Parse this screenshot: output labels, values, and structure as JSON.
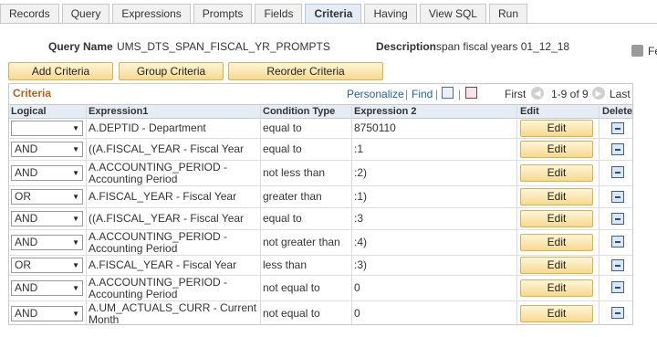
{
  "tabs": [
    {
      "label": "Records"
    },
    {
      "label": "Query"
    },
    {
      "label": "Expressions"
    },
    {
      "label": "Prompts"
    },
    {
      "label": "Fields"
    },
    {
      "label": "Criteria"
    },
    {
      "label": "Having"
    },
    {
      "label": "View SQL"
    },
    {
      "label": "Run"
    }
  ],
  "header": {
    "query_name_label": "Query Name",
    "query_name_value": "UMS_DTS_SPAN_FISCAL_YR_PROMPTS",
    "description_label": "Description",
    "description_value": "span fiscal years 01_12_18",
    "rss_icon": "rss-icon",
    "clipped_text": "Fe"
  },
  "buttons": {
    "add": "Add Criteria",
    "group": "Group Criteria",
    "reorder": "Reorder Criteria"
  },
  "grid": {
    "title": "Criteria",
    "personalize": "Personalize",
    "sep": "|",
    "find": "Find",
    "first": "First",
    "range": "1-9 of 9",
    "last": "Last",
    "columns": {
      "logical": "Logical",
      "expression1": "Expression1",
      "condition": "Condition Type",
      "expression2": "Expression 2",
      "edit": "Edit",
      "delete": "Delete"
    },
    "edit_label": "Edit",
    "rows": [
      {
        "logical": "",
        "expr1a": "A.DEPTID - Department",
        "expr1b": "",
        "condition": "equal to",
        "expr2": "8750110"
      },
      {
        "logical": "AND",
        "expr1a": "((A.FISCAL_YEAR - Fiscal Year",
        "expr1b": "",
        "condition": "equal to",
        "expr2": ":1"
      },
      {
        "logical": "AND",
        "expr1a": "A.ACCOUNTING_PERIOD -",
        "expr1b": "Accounting Period",
        "condition": "not less than",
        "expr2": ":2)"
      },
      {
        "logical": "OR",
        "expr1a": "A.FISCAL_YEAR - Fiscal Year",
        "expr1b": "",
        "condition": "greater than",
        "expr2": ":1)"
      },
      {
        "logical": "AND",
        "expr1a": "((A.FISCAL_YEAR - Fiscal Year",
        "expr1b": "",
        "condition": "equal to",
        "expr2": ":3"
      },
      {
        "logical": "AND",
        "expr1a": "A.ACCOUNTING_PERIOD -",
        "expr1b": "Accounting Period",
        "condition": "not greater than",
        "expr2": ":4)"
      },
      {
        "logical": "OR",
        "expr1a": "A.FISCAL_YEAR - Fiscal Year",
        "expr1b": "",
        "condition": "less than",
        "expr2": ":3)"
      },
      {
        "logical": "AND",
        "expr1a": "A.ACCOUNTING_PERIOD -",
        "expr1b": "Accounting Period",
        "condition": "not equal to",
        "expr2": "0"
      },
      {
        "logical": "AND",
        "expr1a": "A.UM_ACTUALS_CURR - Current",
        "expr1b": "Month",
        "condition": "not equal to",
        "expr2": "0"
      }
    ]
  }
}
